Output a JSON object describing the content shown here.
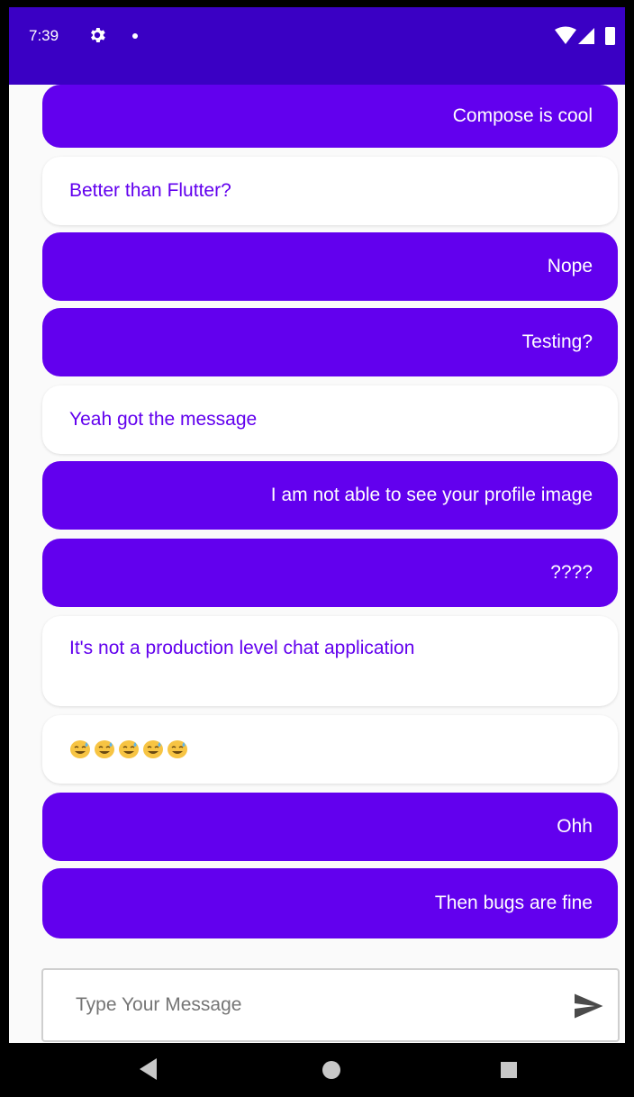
{
  "status_bar": {
    "time": "7:39",
    "icons": [
      "gear-icon",
      "notification-dot-icon",
      "wifi-icon",
      "signal-icon",
      "battery-icon"
    ]
  },
  "messages": [
    {
      "text": "Compose is cool",
      "from": "me"
    },
    {
      "text": "Better than Flutter?",
      "from": "other"
    },
    {
      "text": "Nope",
      "from": "me"
    },
    {
      "text": "Testing?",
      "from": "me"
    },
    {
      "text": "Yeah got the message",
      "from": "other"
    },
    {
      "text": "I am not able to see your profile image",
      "from": "me"
    },
    {
      "text": "????",
      "from": "me"
    },
    {
      "text": "It's not a production level chat application",
      "from": "other"
    },
    {
      "text": "😅😅😅😅😅",
      "from": "other"
    },
    {
      "text": "Ohh",
      "from": "me"
    },
    {
      "text": "Then bugs are fine",
      "from": "me"
    }
  ],
  "composer": {
    "placeholder": "Type Your Message",
    "send_icon": "send-icon"
  },
  "nav_bar": {
    "icons": [
      "back-icon",
      "home-icon",
      "recents-icon"
    ]
  },
  "colors": {
    "status_bar": "#3a00c4",
    "sent_bubble": "#6200ee",
    "received_text": "#6200ee",
    "background": "#fafafa"
  }
}
